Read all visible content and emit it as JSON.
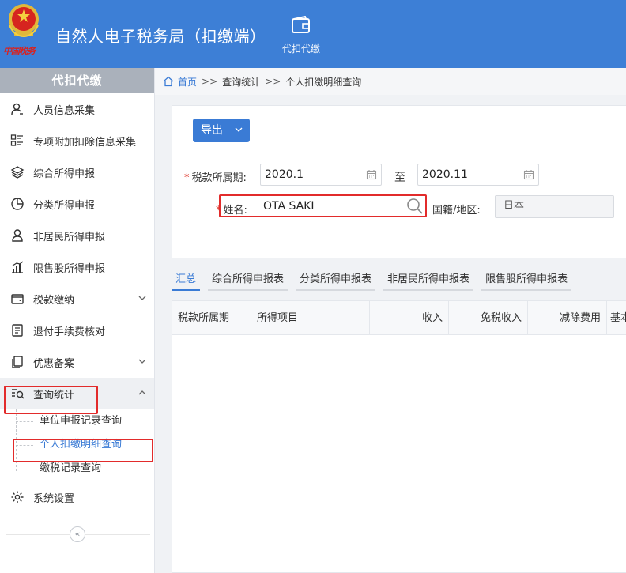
{
  "header": {
    "brand_text": "中国税务",
    "app_title": "自然人电子税务局（扣缴端）",
    "nav_module_label": "代扣代缴"
  },
  "sidebar": {
    "title": "代扣代缴",
    "items": [
      {
        "label": "人员信息采集",
        "icon": "person-icon"
      },
      {
        "label": "专项附加扣除信息采集",
        "icon": "list-icon"
      },
      {
        "label": "综合所得申报",
        "icon": "layers-icon"
      },
      {
        "label": "分类所得申报",
        "icon": "pie-chart-icon"
      },
      {
        "label": "非居民所得申报",
        "icon": "person-outline-icon"
      },
      {
        "label": "限售股所得申报",
        "icon": "bar-chart-icon"
      },
      {
        "label": "税款缴纳",
        "icon": "wallet-icon",
        "expandable": true
      },
      {
        "label": "退付手续费核对",
        "icon": "document-icon"
      },
      {
        "label": "优惠备案",
        "icon": "copy-icon",
        "expandable": true
      },
      {
        "label": "查询统计",
        "icon": "search-list-icon",
        "expanded": true
      }
    ],
    "query_submenu": [
      {
        "label": "单位申报记录查询"
      },
      {
        "label": "个人扣缴明细查询",
        "active": true
      },
      {
        "label": "缴税记录查询"
      }
    ],
    "settings_label": "系统设置",
    "collapse_symbol": "«"
  },
  "breadcrumb": {
    "home": "首页",
    "sep": ">>",
    "level1": "查询统计",
    "level2": "个人扣缴明细查询"
  },
  "toolbar": {
    "export_label": "导出"
  },
  "filters": {
    "period_label": "税款所属期:",
    "required_mark": "*",
    "period_start": "2020.1",
    "period_to": "至",
    "period_end": "2020.11",
    "name_label": "姓名:",
    "name_value": "OTA SAKI",
    "nationality_label": "国籍/地区:",
    "nationality_value": "日本"
  },
  "tabs": [
    {
      "label": "汇总",
      "active": true
    },
    {
      "label": "综合所得申报表"
    },
    {
      "label": "分类所得申报表"
    },
    {
      "label": "非居民所得申报表"
    },
    {
      "label": "限售股所得申报表"
    }
  ],
  "table": {
    "columns": [
      "税款所属期",
      "所得项目",
      "收入",
      "免税收入",
      "减除费用",
      "基本"
    ]
  },
  "colors": {
    "header_blue": "#3d7fd6",
    "accent_blue": "#3a7bd5",
    "highlight_red": "#e22b2b"
  }
}
